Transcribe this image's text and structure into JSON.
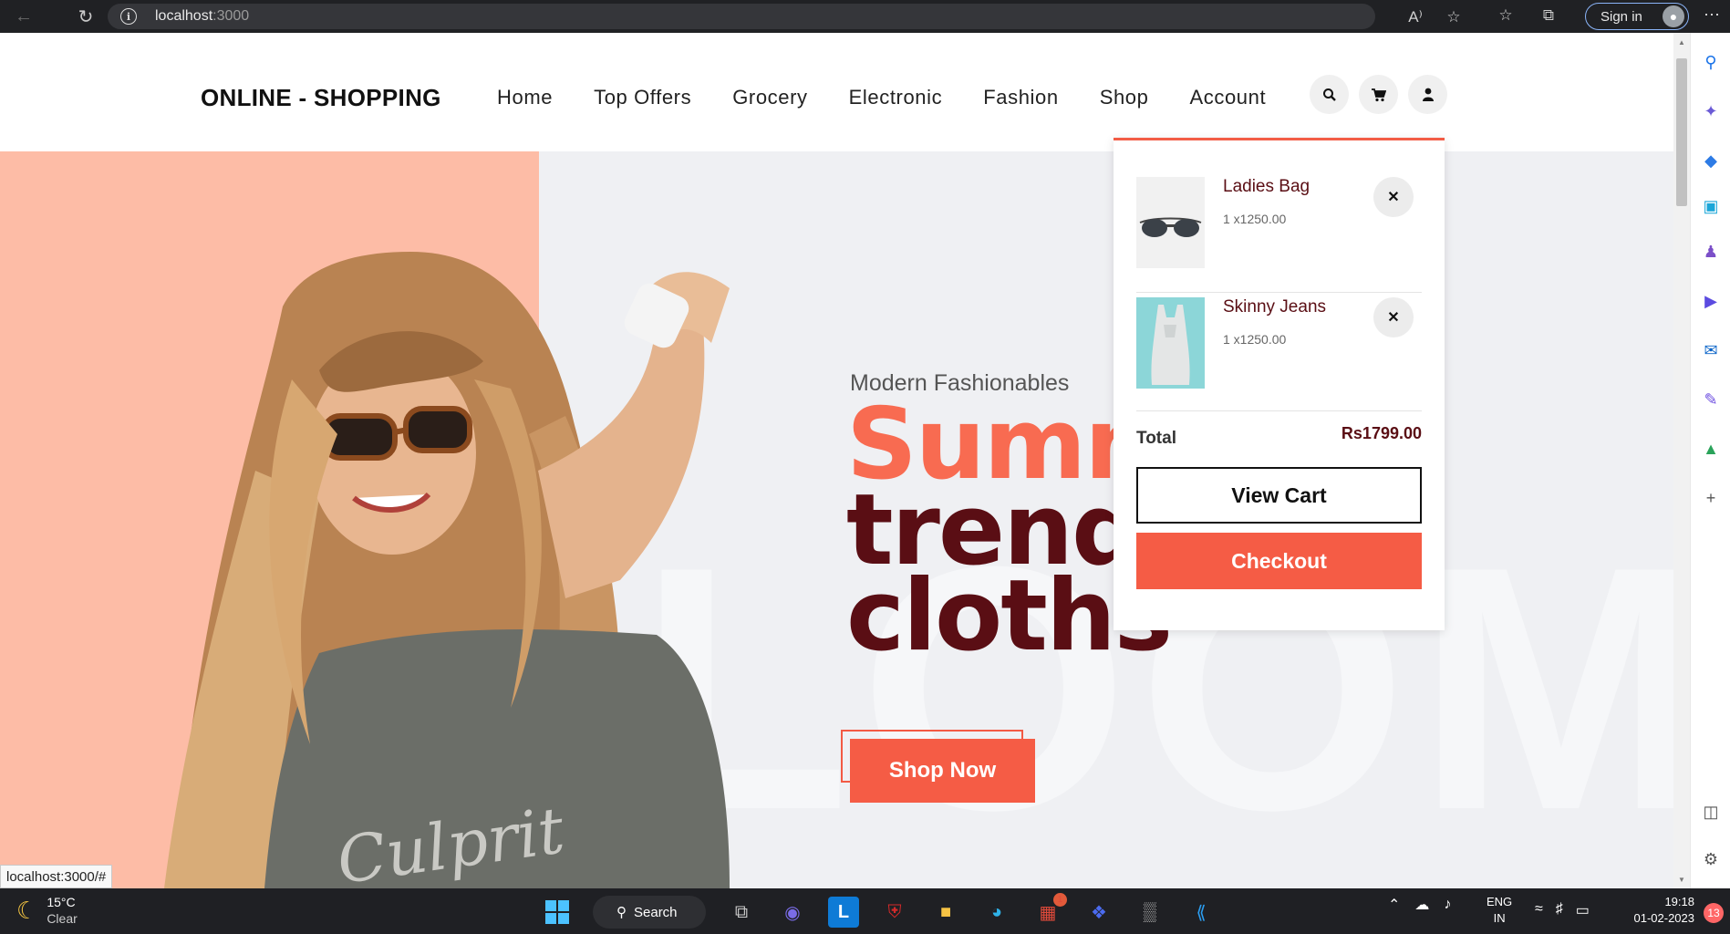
{
  "browser": {
    "url_host": "localhost",
    "url_port": ":3000",
    "signin_label": "Sign in"
  },
  "site": {
    "logo": "ONLINE - SHOPPING",
    "nav": [
      "Home",
      "Top Offers",
      "Grocery",
      "Electronic",
      "Fashion",
      "Shop",
      "Account"
    ]
  },
  "hero": {
    "subtitle": "Modern Fashionables",
    "title_line1": "Summer",
    "title_line2": "trendy",
    "title_line3": "cloths",
    "cta": "Shop Now",
    "watermark": "LOOM"
  },
  "cart": {
    "items": [
      {
        "name": "Ladies Bag",
        "qty": "1 x1250.00"
      },
      {
        "name": "Skinny Jeans",
        "qty": "1 x1250.00"
      }
    ],
    "total_label": "Total",
    "total_value": "Rs1799.00",
    "view_cart": "View Cart",
    "checkout": "Checkout"
  },
  "status_url": "localhost:3000/#",
  "taskbar": {
    "temp": "15°C",
    "condition": "Clear",
    "search": "Search",
    "lang1": "ENG",
    "lang2": "IN",
    "time": "19:18",
    "date": "01-02-2023",
    "notifications": "13",
    "store_badge": "1"
  },
  "colors": {
    "accent": "#f55c45",
    "maroon": "#5a0e14",
    "hero_pink": "#fdbca6",
    "hero_bg": "#eff0f3"
  }
}
